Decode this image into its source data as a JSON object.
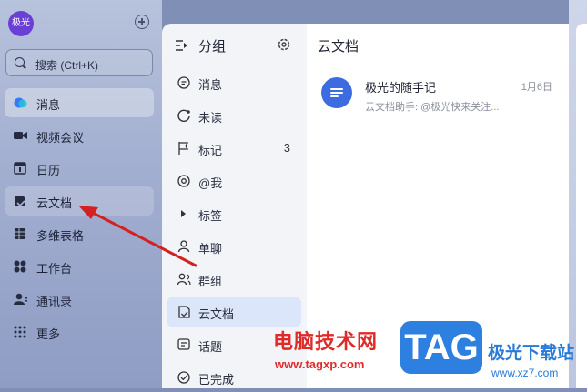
{
  "sidebar": {
    "avatar_text": "极光",
    "search_placeholder": "搜索 (Ctrl+K)",
    "items": [
      {
        "label": "消息",
        "icon": "message-bubble-icon",
        "state": "active"
      },
      {
        "label": "视频会议",
        "icon": "video-camera-icon"
      },
      {
        "label": "日历",
        "icon": "calendar-icon"
      },
      {
        "label": "云文档",
        "icon": "cloud-doc-icon",
        "state": "hover"
      },
      {
        "label": "多维表格",
        "icon": "table-grid-icon"
      },
      {
        "label": "工作台",
        "icon": "workspace-grid-icon"
      },
      {
        "label": "通讯录",
        "icon": "contacts-icon"
      },
      {
        "label": "更多",
        "icon": "more-dots-icon"
      }
    ]
  },
  "groups": {
    "title": "分组",
    "items": [
      {
        "label": "消息",
        "icon": "message-icon"
      },
      {
        "label": "未读",
        "icon": "unread-icon"
      },
      {
        "label": "标记",
        "icon": "flag-icon",
        "count": "3"
      },
      {
        "label": "@我",
        "icon": "at-icon"
      },
      {
        "label": "标签",
        "icon": "triangle-right-icon"
      },
      {
        "label": "单聊",
        "icon": "person-icon"
      },
      {
        "label": "群组",
        "icon": "group-icon"
      },
      {
        "label": "云文档",
        "icon": "cloud-doc-icon",
        "state": "active"
      },
      {
        "label": "话题",
        "icon": "topic-icon"
      },
      {
        "label": "已完成",
        "icon": "check-circle-icon"
      }
    ]
  },
  "conversation_panel": {
    "title": "云文档",
    "conversations": [
      {
        "name": "极光的随手记",
        "date": "1月6日",
        "preview": "云文档助手: @极光快来关注..."
      }
    ]
  },
  "watermark": {
    "site_cn": "电脑技术网",
    "site_url": "www.tagxp.com",
    "logo_text": "TAG",
    "site2_cn": "极光下载站",
    "site2_url": "www.xz7.com"
  },
  "colors": {
    "accent": "#3c6ce0",
    "annotation_arrow": "#d42020"
  }
}
